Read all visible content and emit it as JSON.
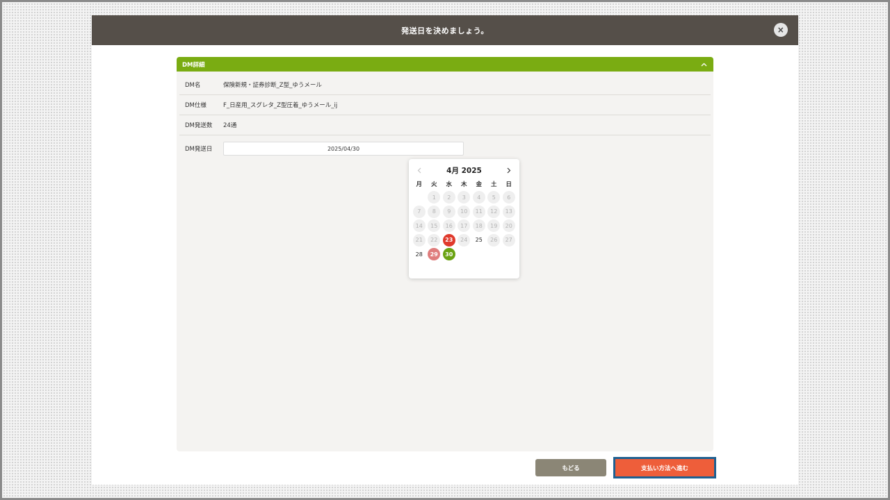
{
  "modal": {
    "title": "発送日を決めましょう。",
    "close_icon": "×"
  },
  "panel": {
    "title": "DM詳細",
    "rows": [
      {
        "label": "DM名",
        "value": "保険新規・証券診断_Z型_ゆうメール"
      },
      {
        "label": "DM仕様",
        "value": "F_日産用_スグレタ_Z型圧着_ゆうメール_ij"
      },
      {
        "label": "DM発送数",
        "value": "24通"
      }
    ],
    "date_label": "DM発送日",
    "date_value": "2025/04/30"
  },
  "calendar": {
    "title": "4月 2025",
    "weekdays": [
      "月",
      "火",
      "水",
      "木",
      "金",
      "土",
      "日"
    ],
    "days": [
      {
        "label": "",
        "state": "empty"
      },
      {
        "label": "1",
        "state": "disabled"
      },
      {
        "label": "2",
        "state": "disabled"
      },
      {
        "label": "3",
        "state": "disabled"
      },
      {
        "label": "4",
        "state": "disabled"
      },
      {
        "label": "5",
        "state": "disabled"
      },
      {
        "label": "6",
        "state": "disabled"
      },
      {
        "label": "7",
        "state": "disabled"
      },
      {
        "label": "8",
        "state": "disabled"
      },
      {
        "label": "9",
        "state": "disabled"
      },
      {
        "label": "10",
        "state": "disabled"
      },
      {
        "label": "11",
        "state": "disabled"
      },
      {
        "label": "12",
        "state": "disabled"
      },
      {
        "label": "13",
        "state": "disabled"
      },
      {
        "label": "14",
        "state": "disabled"
      },
      {
        "label": "15",
        "state": "disabled"
      },
      {
        "label": "16",
        "state": "disabled"
      },
      {
        "label": "17",
        "state": "disabled"
      },
      {
        "label": "18",
        "state": "disabled"
      },
      {
        "label": "19",
        "state": "disabled"
      },
      {
        "label": "20",
        "state": "disabled"
      },
      {
        "label": "21",
        "state": "disabled"
      },
      {
        "label": "22",
        "state": "disabled"
      },
      {
        "label": "23",
        "state": "today"
      },
      {
        "label": "24",
        "state": "disabled"
      },
      {
        "label": "25",
        "state": "avail"
      },
      {
        "label": "26",
        "state": "disabled"
      },
      {
        "label": "27",
        "state": "disabled"
      },
      {
        "label": "28",
        "state": "avail"
      },
      {
        "label": "29",
        "state": "holiday"
      },
      {
        "label": "30",
        "state": "selected"
      }
    ]
  },
  "buttons": {
    "back": "もどる",
    "next": "支払い方法へ進む"
  },
  "colors": {
    "header": "#554f49",
    "accent_green": "#7aac12",
    "today_red": "#e03a2c",
    "next_button": "#ee5e3a",
    "back_button": "#8b8676"
  }
}
